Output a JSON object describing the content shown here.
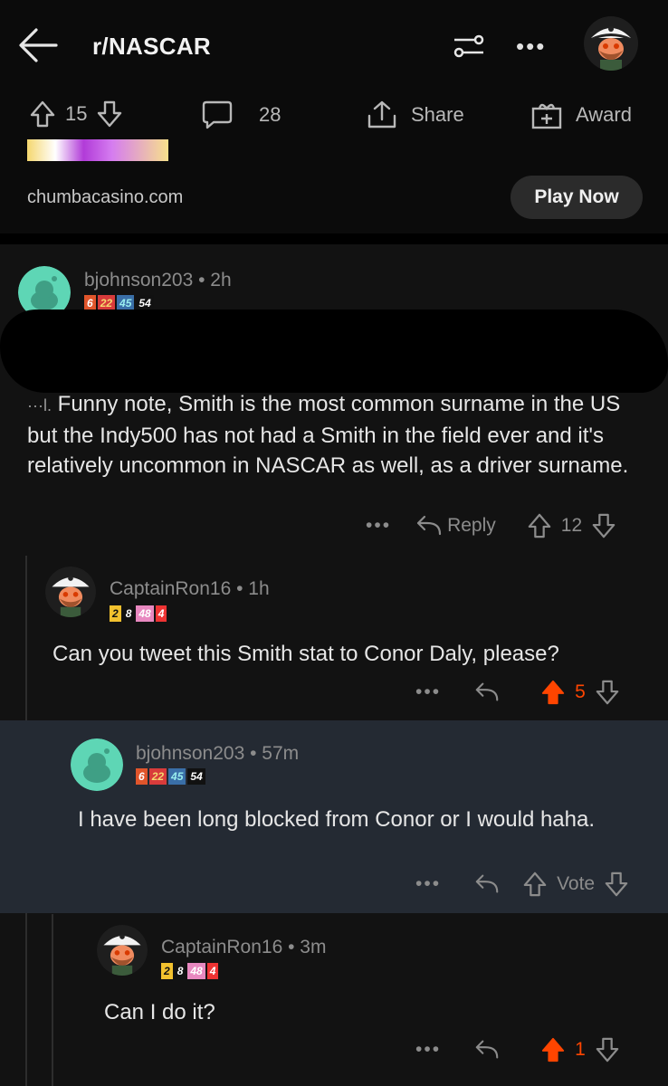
{
  "header": {
    "title": "r/NASCAR"
  },
  "post_actions": {
    "upvotes": "15",
    "comments": "28",
    "share_label": "Share",
    "award_label": "Award"
  },
  "ad": {
    "domain": "chumbacasino.com",
    "cta": "Play Now"
  },
  "comments": [
    {
      "user": "bjohnson203",
      "meta": "• 2h",
      "flair": [
        "6",
        "22",
        "45",
        "54"
      ],
      "text": "Funny note, Smith is the most common surname in the US but the Indy500 has not had a Smith in the field ever and it's relatively uncommon in NASCAR as well, as a driver surname.",
      "partial_prefix": "···l.",
      "reply_label": "Reply",
      "score": "12"
    },
    {
      "user": "CaptainRon16",
      "meta": "• 1h",
      "flair": [
        "2",
        "8",
        "48",
        "4"
      ],
      "text": "Can you tweet this Smith stat to Conor Daly, please?",
      "score": "5"
    },
    {
      "user": "bjohnson203",
      "meta": "• 57m",
      "flair": [
        "6",
        "22",
        "45",
        "54"
      ],
      "text": "I have been long blocked from Conor or I would haha.",
      "vote_label": "Vote"
    },
    {
      "user": "CaptainRon16",
      "meta": "• 3m",
      "flair": [
        "2",
        "8",
        "48",
        "4"
      ],
      "text": "Can I do it?",
      "score": "1"
    }
  ],
  "colors": {
    "upvote_active": "#ff4500",
    "highlight_bg": "#242a33",
    "snoo_bg": "#5ed6b5"
  }
}
